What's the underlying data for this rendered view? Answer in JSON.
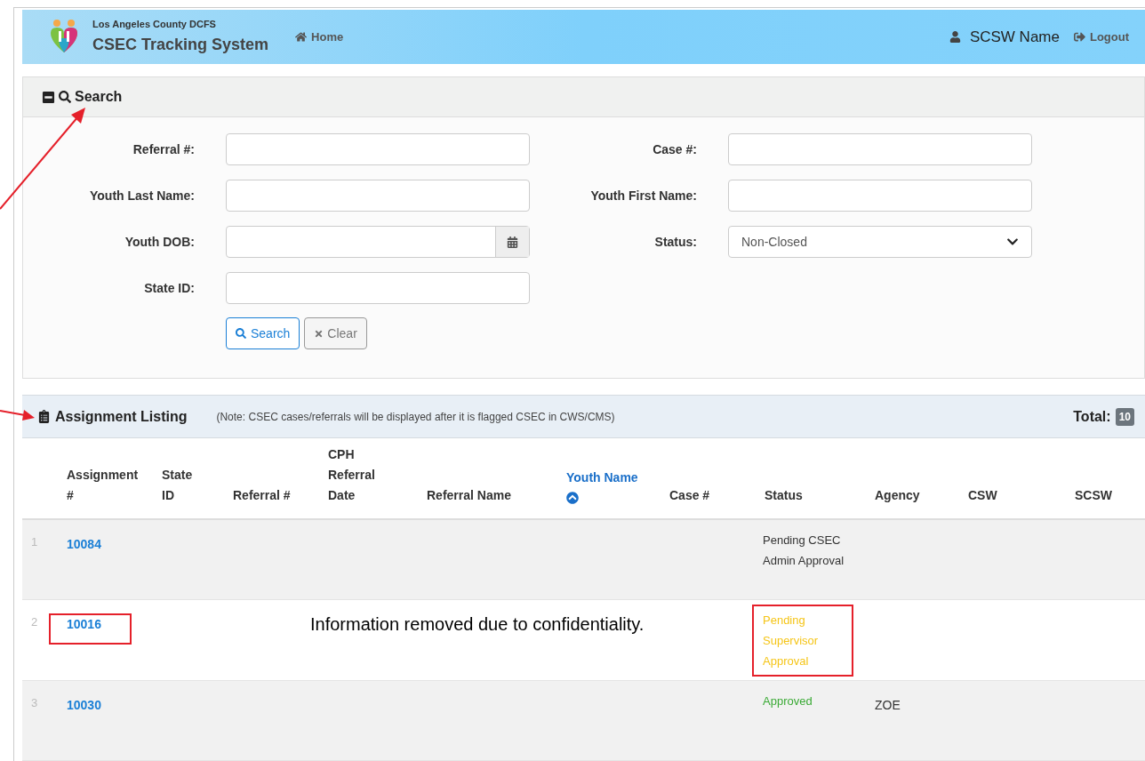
{
  "header": {
    "org": "Los Angeles County DCFS",
    "title": "CSEC Tracking System",
    "nav": [
      {
        "label": "Home"
      }
    ],
    "user": "SCSW Name",
    "logout": "Logout"
  },
  "search": {
    "title": "Search",
    "expanded": true,
    "fields": [
      {
        "label": "Referral #:",
        "kind": "text"
      },
      {
        "label": "Case #:",
        "kind": "text"
      },
      {
        "label": "Youth Last Name:",
        "kind": "text"
      },
      {
        "label": "Youth First Name:",
        "kind": "text"
      },
      {
        "label": "Youth DOB:",
        "kind": "date"
      },
      {
        "label": "Status:",
        "kind": "select",
        "value": "Non-Closed"
      },
      {
        "label": "State ID:",
        "kind": "text"
      }
    ],
    "buttons": [
      {
        "label": "Search",
        "kind": "primary"
      },
      {
        "label": "Clear",
        "kind": "secondary"
      }
    ]
  },
  "listing": {
    "title": "Assignment Listing",
    "note": "(Note: CSEC cases/referrals will be displayed after it is flagged CSEC in CWS/CMS)",
    "total_label": "Total:",
    "total": "10",
    "columns": [
      {
        "label": "Assignment #",
        "sorted": false
      },
      {
        "label": "State ID",
        "sorted": false
      },
      {
        "label": "Referral #",
        "sorted": false
      },
      {
        "label": "CPH Referral Date",
        "sorted": false
      },
      {
        "label": "Referral Name",
        "sorted": false
      },
      {
        "label": "Youth Name",
        "sorted": true
      },
      {
        "label": "Case #",
        "sorted": false
      },
      {
        "label": "Status",
        "sorted": false
      },
      {
        "label": "Agency",
        "sorted": false
      },
      {
        "label": "CSW",
        "sorted": false
      },
      {
        "label": "SCSW",
        "sorted": false
      }
    ],
    "rows": [
      {
        "number": "1",
        "assignment": "10084",
        "status": "Pending CSEC Admin Approval",
        "color": "#333333",
        "agency": "",
        "highlighted": false
      },
      {
        "number": "2",
        "assignment": "10016",
        "status": "Pending Supervisor Approval",
        "color": "#f5c518",
        "agency": "",
        "highlighted": true,
        "overlay_note": "Information removed due to confidentiality."
      },
      {
        "number": "3",
        "assignment": "10030",
        "status": "Approved",
        "color": "#3aaa35",
        "agency": "ZOE",
        "highlighted": false
      }
    ]
  }
}
